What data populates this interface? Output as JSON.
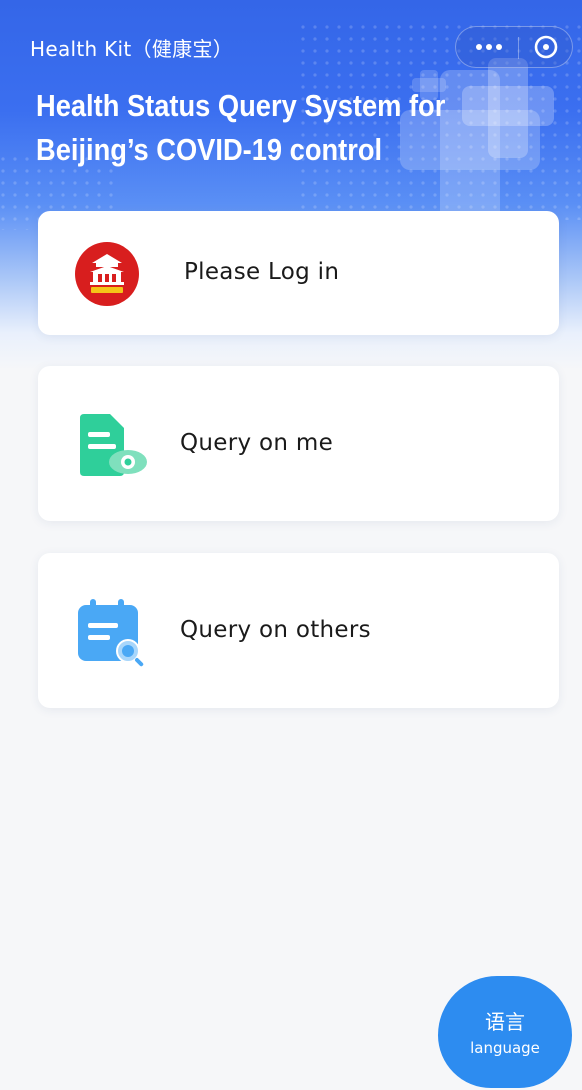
{
  "header": {
    "app_title": "Health Kit（健康宝）",
    "hero_title_line1": "Health Status Query System for",
    "hero_title_line2": "Beijing’s COVID-19 control",
    "more_icon": "more-dots-icon",
    "close_icon": "close-circle-icon"
  },
  "cards": {
    "login": {
      "label": "Please Log in",
      "icon": "beijing-health-kit-logo"
    },
    "me": {
      "label": "Query on me",
      "icon": "document-eye-icon"
    },
    "others": {
      "label": "Query on others",
      "icon": "calendar-search-icon"
    }
  },
  "language_button": {
    "zh_label": "语言",
    "en_label": "language"
  },
  "colors": {
    "header_blue": "#3466e8",
    "fab_blue": "#2d8cf0",
    "logo_red": "#d81e1e",
    "doc_green": "#2fcf9a",
    "calendar_blue": "#4aa8f5"
  }
}
